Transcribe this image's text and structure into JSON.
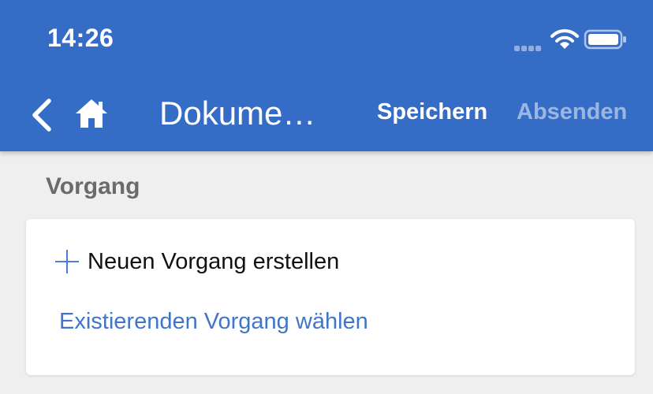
{
  "status_bar": {
    "time": "14:26"
  },
  "nav": {
    "title": "Dokume…",
    "save_label": "Speichern",
    "send_label": "Absenden",
    "icons": [
      "back-icon",
      "home-icon"
    ]
  },
  "section": {
    "title": "Vorgang"
  },
  "card": {
    "create_label": "Neuen Vorgang erstellen",
    "choose_label": "Existierenden Vorgang wählen"
  },
  "colors": {
    "header": "#356cc6",
    "background": "#efefef",
    "link": "#3f76c8",
    "section_title": "#6b6b6b"
  }
}
